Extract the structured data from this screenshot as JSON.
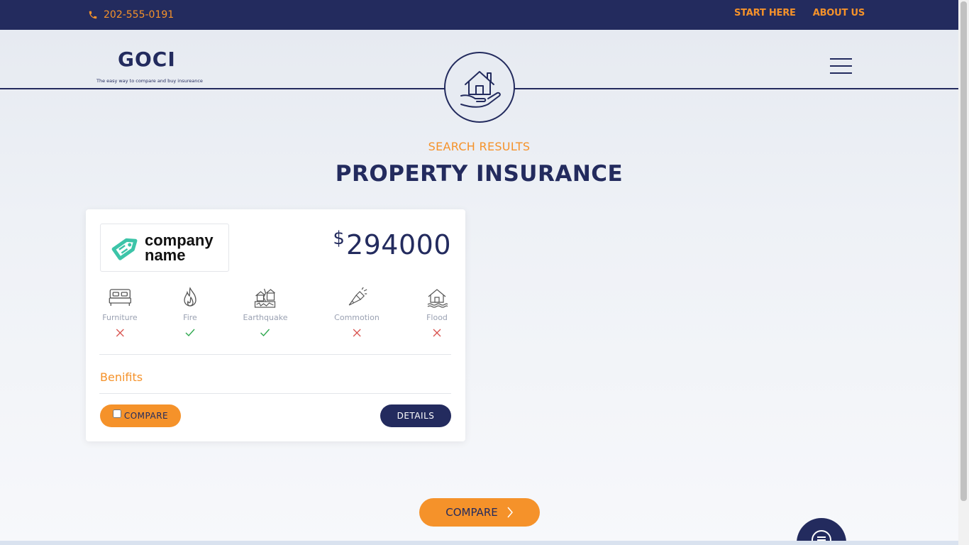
{
  "topbar": {
    "phone": "202-555-0191",
    "nav": [
      "START HERE",
      "ABOUT US"
    ]
  },
  "header": {
    "logo_text": "GOCI",
    "logo_tagline": "The easy way to compare and buy insureance"
  },
  "page": {
    "subtitle": "SEARCH RESULTS",
    "title": "PROPERTY INSURANCE"
  },
  "result": {
    "company_line1": "company",
    "company_line2": "name",
    "currency": "$",
    "price": "294000",
    "coverage": [
      {
        "label": "Furniture",
        "icon": "bed-icon",
        "covered": false
      },
      {
        "label": "Fire",
        "icon": "fire-icon",
        "covered": true
      },
      {
        "label": "Earthquake",
        "icon": "earthquake-icon",
        "covered": true
      },
      {
        "label": "Commotion",
        "icon": "commotion-icon",
        "covered": false
      },
      {
        "label": "Flood",
        "icon": "flood-icon",
        "covered": false
      }
    ],
    "benefits_label": "Benifits",
    "compare_label": "COMPARE",
    "details_label": "DETAILS"
  },
  "footer": {
    "compare_label": "COMPARE"
  },
  "colors": {
    "navy": "#232b5e",
    "orange": "#f5922a",
    "check": "#2fa84f",
    "cross": "#d9534f",
    "teal": "#3cc4a8"
  }
}
